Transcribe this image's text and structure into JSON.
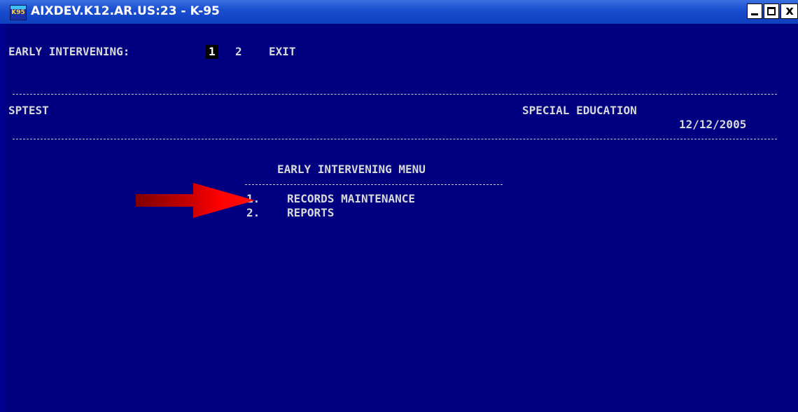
{
  "window": {
    "title": "AIXDEV.K12.AR.US:23 - K-95",
    "icon_text": "K95",
    "minimize": "",
    "maximize": "",
    "close": "x"
  },
  "menubar": {
    "label": "EARLY INTERVENING:",
    "options": [
      "1",
      "2",
      "EXIT"
    ],
    "selected": "1"
  },
  "header": {
    "user": "SPTEST",
    "module": "SPECIAL EDUCATION",
    "date": "12/12/2005"
  },
  "menu": {
    "title": "EARLY INTERVENING MENU",
    "items": [
      {
        "number": "1.",
        "label": "RECORDS MAINTENANCE"
      },
      {
        "number": "2.",
        "label": "REPORTS"
      }
    ]
  },
  "colors": {
    "terminal_bg": "#000080",
    "terminal_text": "#d8d8d8",
    "arrow": "#ff0000"
  }
}
